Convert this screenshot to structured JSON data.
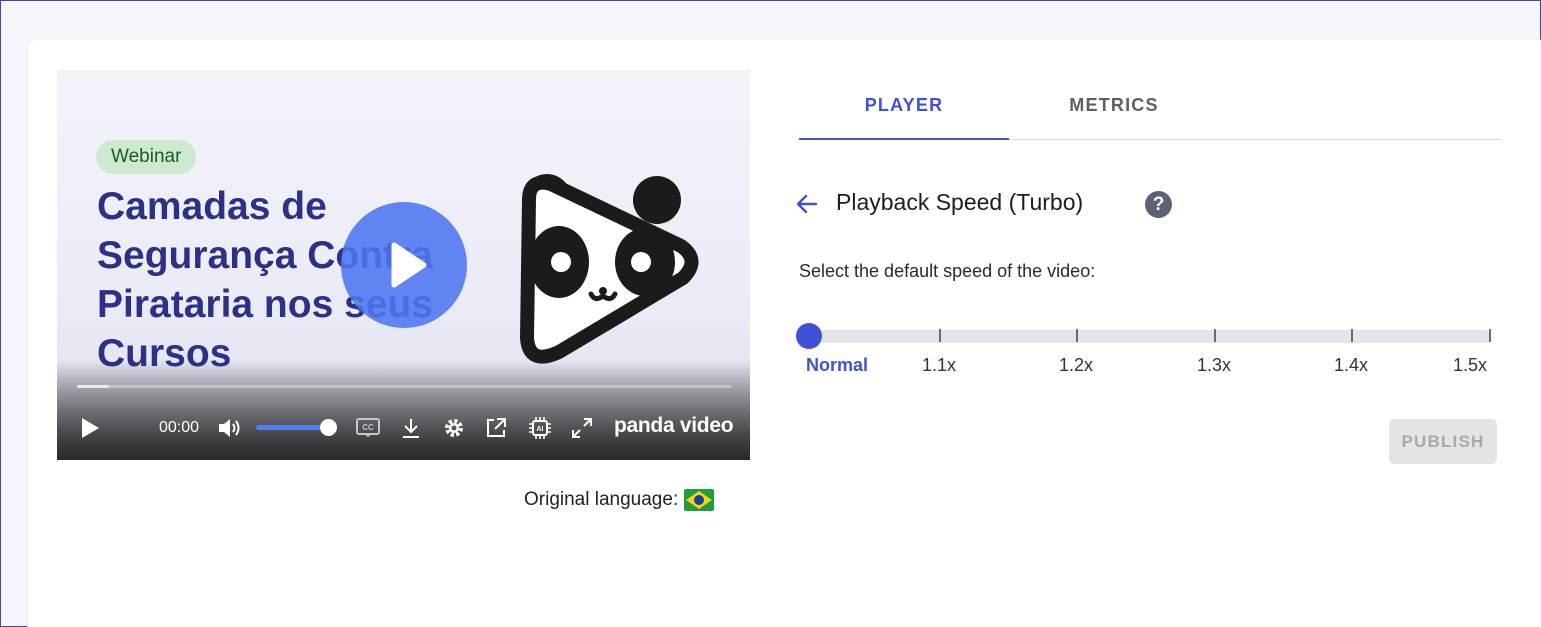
{
  "video": {
    "badge": "Webinar",
    "headline": "Camadas de Segurança Contra Pirataria nos seus Cursos",
    "time": "00:00",
    "brand": "panda video",
    "volume_percent": 100,
    "progress_percent": 0,
    "icons": [
      "play-icon",
      "volume-icon",
      "captions-icon",
      "download-icon",
      "settings-icon",
      "open-external-icon",
      "ai-chip-icon",
      "fullscreen-icon"
    ]
  },
  "original_language": {
    "label": "Original language:",
    "flag": "brazil-flag-icon"
  },
  "tabs": {
    "player": "PLAYER",
    "metrics": "METRICS",
    "active": "PLAYER"
  },
  "section": {
    "title": "Playback Speed (Turbo)",
    "help": "?",
    "description": "Select the default speed of the video:"
  },
  "speed_slider": {
    "options": [
      "Normal",
      "1.1x",
      "1.2x",
      "1.3x",
      "1.4x",
      "1.5x"
    ],
    "selected": "Normal"
  },
  "actions": {
    "publish": "PUBLISH"
  },
  "colors": {
    "accent": "#3f51d5",
    "play_button": "#4c76f0",
    "headline": "#2b3286",
    "badge_bg": "#cde9cf"
  }
}
